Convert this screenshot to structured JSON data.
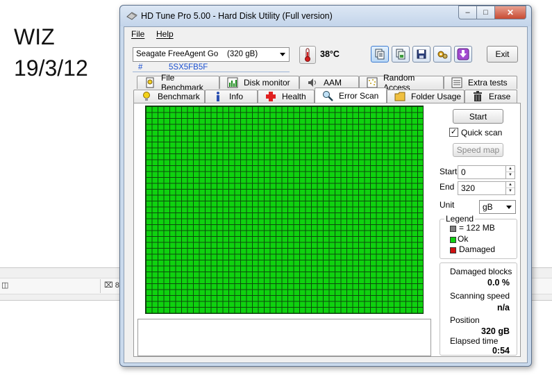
{
  "desktop": {
    "note_line1": "WIZ",
    "note_line2": "19/3/12",
    "taskbar_left_glyph": "◫",
    "taskbar_item": "⌧ 8"
  },
  "window": {
    "title": "HD Tune Pro 5.00 - Hard Disk Utility (Full version)",
    "minimize": "‒",
    "maximize": "□",
    "close": "✕"
  },
  "menu": {
    "file": "File",
    "help": "Help"
  },
  "toolbar": {
    "drive": "Seagate FreeAgent Go    (320 gB)",
    "hash": "#",
    "serial": "5SX5FB5F",
    "temperature": "38°C",
    "exit": "Exit",
    "icons": [
      "copy-text-icon",
      "copy-screenshot-icon",
      "save-icon",
      "options-icon",
      "download-icon"
    ]
  },
  "tabs": {
    "row1": [
      "File Benchmark",
      "Disk monitor",
      "AAM",
      "Random Access",
      "Extra tests"
    ],
    "row2": [
      "Benchmark",
      "Info",
      "Health",
      "Error Scan",
      "Folder Usage",
      "Erase"
    ],
    "active": "Error Scan"
  },
  "error_scan": {
    "start_button": "Start",
    "quick_scan_label": "Quick scan",
    "quick_scan_checked": true,
    "check_mark": "✓",
    "speed_map_button": "Speed map",
    "start_label": "Start",
    "start_value": "0",
    "end_label": "End",
    "end_value": "320",
    "unit_label": "Unit",
    "unit_value": "gB",
    "spin_up": "▲",
    "spin_down": "▼",
    "legend_title": "Legend",
    "legend_block": "= 122 MB",
    "legend_ok": "Ok",
    "legend_damaged": "Damaged",
    "colors": {
      "ok": "#10d010",
      "damaged": "#d01010",
      "block": "#808080"
    },
    "damaged_blocks_label": "Damaged blocks",
    "damaged_blocks_value": "0.0 %",
    "scanning_speed_label": "Scanning speed",
    "scanning_speed_value": "n/a",
    "position_label": "Position",
    "position_value": "320 gB",
    "elapsed_label": "Elapsed time",
    "elapsed_value": "0:54"
  }
}
